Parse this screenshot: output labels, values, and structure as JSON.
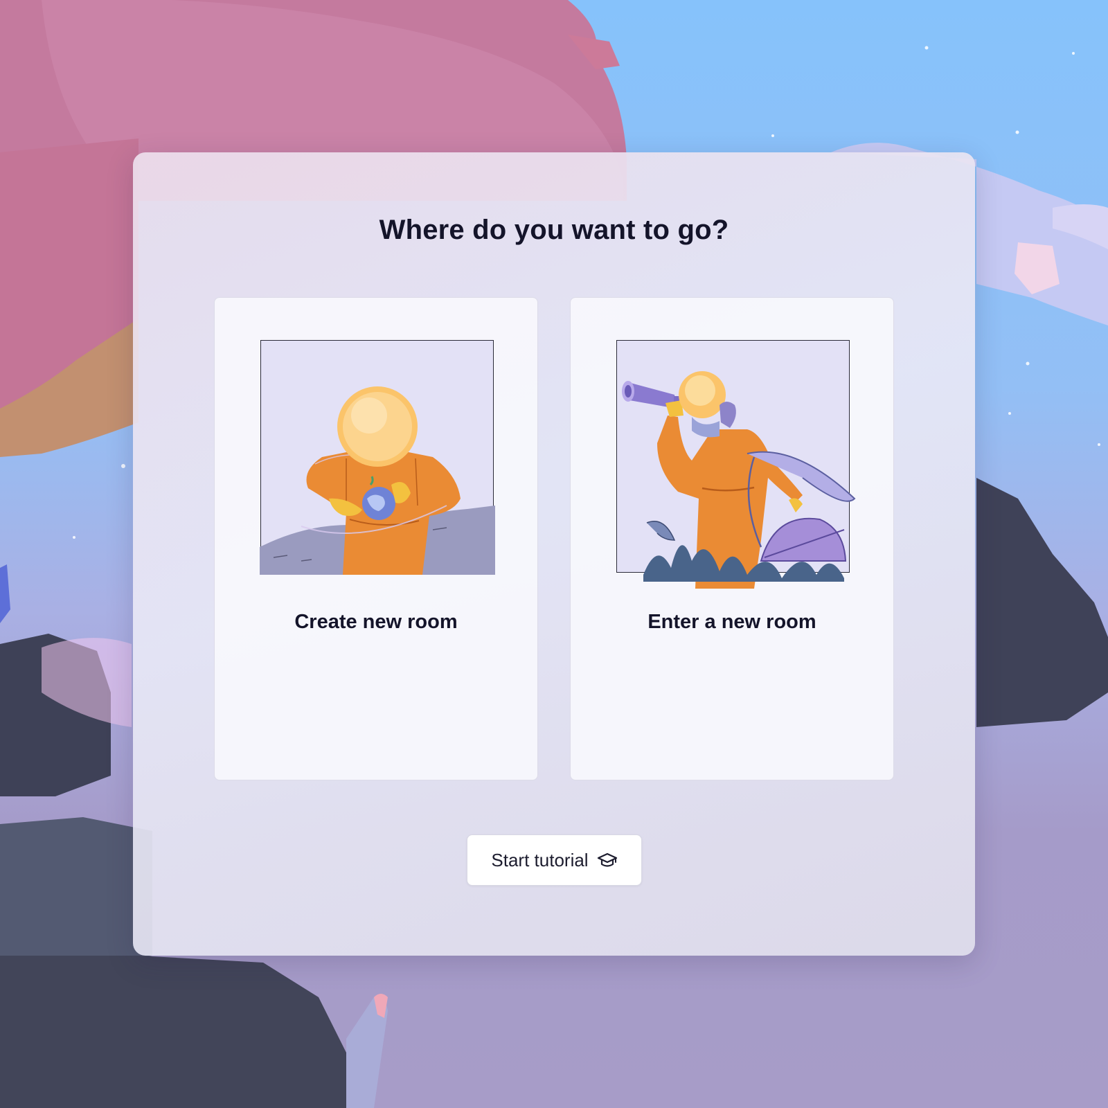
{
  "modal": {
    "title": "Where do you want to go?"
  },
  "cards": [
    {
      "label": "Create new room",
      "illustration": "astronaut-holding-planet"
    },
    {
      "label": "Enter a new room",
      "illustration": "astronaut-with-telescope"
    }
  ],
  "tutorial_button": {
    "label": "Start tutorial",
    "icon": "graduation-cap-icon"
  },
  "colors": {
    "title_text": "#14142a",
    "suit_orange": "#ea8b34",
    "helmet_yellow": "#fbc46a",
    "illustration_bg": "#e3e1f6",
    "sky_blue": "#86c2fb",
    "tree_pink": "#c97aa2"
  }
}
